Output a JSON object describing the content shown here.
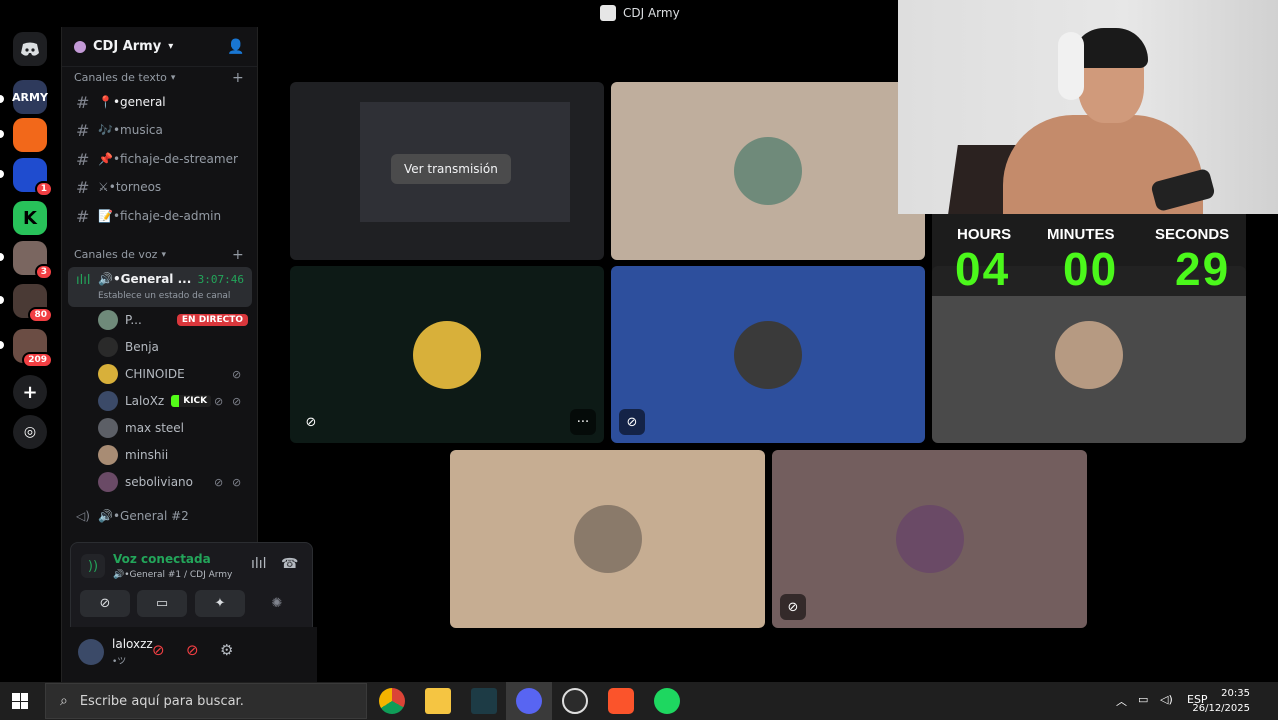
{
  "window": {
    "title": "CDJ Army"
  },
  "guild": {
    "name": "CDJ Army"
  },
  "servers": [
    {
      "label": "ARMY",
      "color": "#2e3a5c",
      "badge": ""
    },
    {
      "label": "",
      "color": "#f2681a",
      "badge": ""
    },
    {
      "label": "",
      "color": "#1f4ccf",
      "badge": "1"
    },
    {
      "label": "K",
      "color": "#28c25a",
      "badge": ""
    },
    {
      "label": "",
      "color": "#7a6660",
      "badge": "3"
    },
    {
      "label": "",
      "color": "#4a3a35",
      "badge": "80"
    },
    {
      "label": "",
      "color": "#6b4d44",
      "badge": "209"
    }
  ],
  "text_category": "Canales de texto",
  "text_channels": [
    "📍•general",
    "🎶•musica",
    "📌•fichaje-de-streamer",
    "⚔•torneos",
    "📝•fichaje-de-admin"
  ],
  "voice_category": "Canales de voz",
  "voice_channel": {
    "name": "🔊•General ...",
    "time": "3:07:46",
    "status": "Establece un estado de canal"
  },
  "voice_users": [
    {
      "name": "P...",
      "live": "EN DIRECTO"
    },
    {
      "name": "Benja"
    },
    {
      "name": "CHINOIDE"
    },
    {
      "name": "LaloXz",
      "tag": "KICK"
    },
    {
      "name": "max steel"
    },
    {
      "name": "minshii"
    },
    {
      "name": "seboliviano"
    }
  ],
  "voice_channel_2": "🔊•General #2",
  "voice_panel": {
    "connected": "Voz conectada",
    "location": "🔊•General #1 / CDJ Army"
  },
  "user": {
    "name": "laloxzz",
    "status": "•ツ"
  },
  "stage": {
    "stream_button": "Ver transmisión"
  },
  "tiles": [
    {
      "bg": "#2b2d31",
      "type": "stream"
    },
    {
      "bg": "#bfae9d",
      "avatar": "#6f8a7a"
    },
    {
      "bg": "#0d1a16",
      "avatar": "#d8b03a"
    },
    {
      "bg": "#2d4f9d",
      "avatar": "#3a3a3a"
    },
    {
      "bg": "#4a4a4a",
      "avatar": "#b69a82"
    },
    {
      "bg": "#c6ad92",
      "avatar": "#8a7a6a"
    },
    {
      "bg": "#735e5e",
      "avatar": "#6a4a66"
    }
  ],
  "timer": {
    "hours_label": "HOURS",
    "minutes_label": "MINUTES",
    "seconds_label": "SECONDS",
    "hours": "04",
    "minutes": "00",
    "seconds": "29"
  },
  "taskbar": {
    "search_placeholder": "Escribe aquí para buscar.",
    "lang": "ESP",
    "time": "20:35",
    "date": "26/12/2025"
  }
}
